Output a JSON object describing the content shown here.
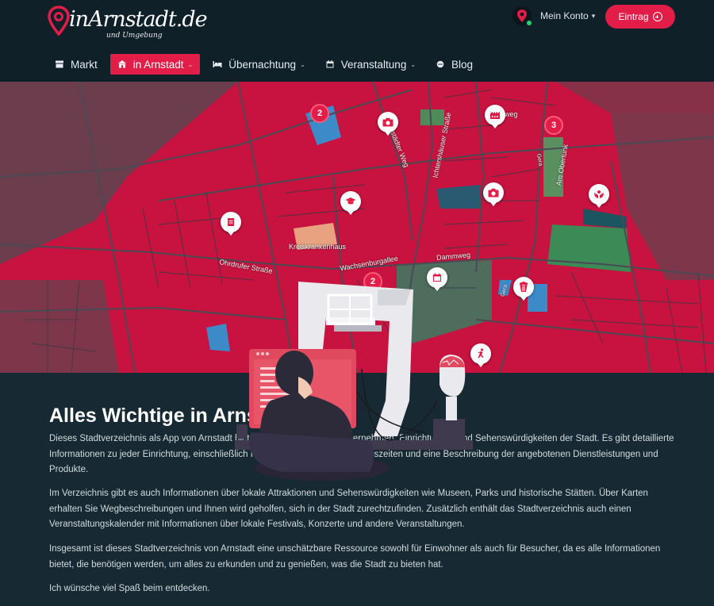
{
  "brand": {
    "name": "inArnstadt.de",
    "tagline": "und Umgebung"
  },
  "account": {
    "label": "Mein Konto"
  },
  "entry_button": {
    "label": "Eintrag"
  },
  "nav": [
    {
      "label": "Markt",
      "icon": "store-icon",
      "dropdown": false,
      "active": false
    },
    {
      "label": "in Arnstadt",
      "icon": "landmark-icon",
      "dropdown": true,
      "active": true
    },
    {
      "label": "Übernachtung",
      "icon": "bed-icon",
      "dropdown": true,
      "active": false
    },
    {
      "label": "Veranstaltung",
      "icon": "calendar-icon",
      "dropdown": true,
      "active": false
    },
    {
      "label": "Blog",
      "icon": "chat-icon",
      "dropdown": false,
      "active": false
    }
  ],
  "map": {
    "streets": [
      "Ohrdrufer Straße",
      "Wachsenburgallee",
      "Dammweg",
      "Ichtershäuser Straße",
      "Rehestädter Weg",
      "Am Obertunk",
      "Kreiskrankenhaus",
      "weg",
      "Gera",
      "Gera"
    ],
    "clusters": [
      "2",
      "3",
      "2"
    ],
    "markers": [
      "camera-icon",
      "factory-icon",
      "camera-icon",
      "hands-icon",
      "graduation-cap-icon",
      "document-icon",
      "calendar-icon",
      "popcorn-icon",
      "running-icon"
    ]
  },
  "colors": {
    "accent": "#e11d48",
    "header_bg": "#0f2029",
    "body_bg": "#172a33"
  },
  "content": {
    "title": "Alles Wichtige in Arnsta",
    "p1": "Dieses Stadtverzeichnis als App von Arnstadt bietet Informationen über Unternehmen, Einrichtungen und Sehenswürdigkeiten der Stadt. Es gibt detaillierte Informationen zu jeder Einrichtung, einschließlich Kontaktinformationen, Öffnungszeiten und eine Beschreibung der angebotenen Dienstleistungen und Produkte.",
    "p2": "Im Verzeichnis gibt es auch Informationen über lokale Attraktionen und Sehenswürdigkeiten wie Museen, Parks und historische Stätten. Über Karten erhalten Sie Wegbeschreibungen und Ihnen wird geholfen, sich in der Stadt zurechtzufinden. Zusätzlich enthält das Stadtverzeichnis auch einen Veranstaltungskalender mit Informationen über lokale Festivals, Konzerte und andere Veranstaltungen.",
    "p3": "Insgesamt ist dieses Stadtverzeichnis von Arnstadt eine unschätzbare Ressource sowohl für Einwohner als auch für Besucher, da es alle Informationen bietet, die benötigen werden, um alles zu erkunden und zu genießen, was die Stadt zu bieten hat.",
    "p4": "Ich wünsche viel Spaß beim entdecken."
  }
}
